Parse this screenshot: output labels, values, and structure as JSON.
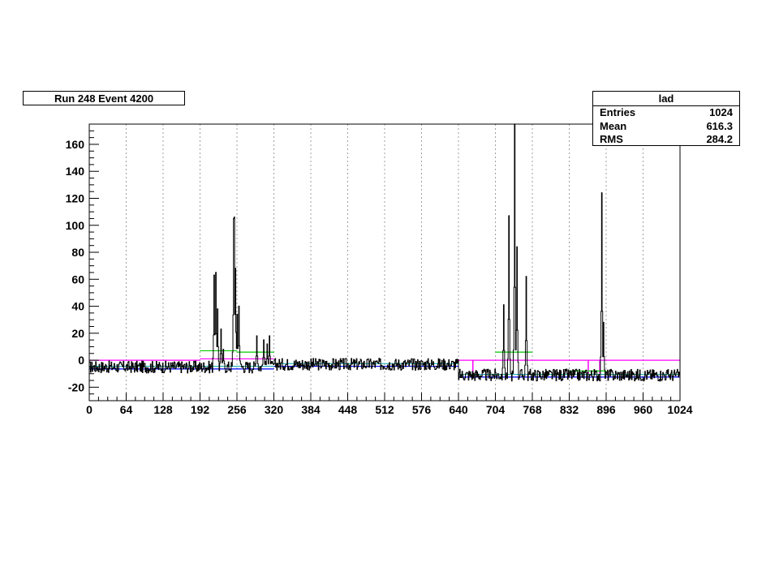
{
  "header": {
    "run_label": "Run 248 Event 4200"
  },
  "stats": {
    "title": "lad",
    "rows": [
      {
        "label": "Entries",
        "value": "1024"
      },
      {
        "label": "Mean",
        "value": "616.3"
      },
      {
        "label": "RMS",
        "value": "284.2"
      }
    ]
  },
  "colors": {
    "signal": "#000000",
    "pedestal": "#00cc00",
    "threshold": "#ff00ff",
    "baseline": "#0000ff",
    "common": "#00aaaa"
  },
  "chart_data": {
    "type": "line",
    "title": "",
    "xlabel": "",
    "ylabel": "",
    "xlim": [
      0,
      1024
    ],
    "ylim": [
      -30,
      175
    ],
    "xticks": [
      0,
      64,
      128,
      192,
      256,
      320,
      384,
      448,
      512,
      576,
      640,
      704,
      768,
      832,
      896,
      960,
      1024
    ],
    "yticks": [
      -20,
      0,
      20,
      40,
      60,
      80,
      100,
      120,
      140,
      160
    ],
    "grid": "vertical-dotted",
    "segments_baseline": [
      {
        "x": [
          0,
          192
        ],
        "y": -5
      },
      {
        "x": [
          192,
          320
        ],
        "y": -5
      },
      {
        "x": [
          320,
          640
        ],
        "y": -3
      },
      {
        "x": [
          640,
          1024
        ],
        "y": -11
      }
    ],
    "peaks": [
      {
        "x": 216,
        "y": 63
      },
      {
        "x": 219,
        "y": 65
      },
      {
        "x": 222,
        "y": 38
      },
      {
        "x": 228,
        "y": 23
      },
      {
        "x": 232,
        "y": 8
      },
      {
        "x": 250,
        "y": 105
      },
      {
        "x": 251,
        "y": 106
      },
      {
        "x": 253,
        "y": 68
      },
      {
        "x": 256,
        "y": 34
      },
      {
        "x": 259,
        "y": 40
      },
      {
        "x": 290,
        "y": 18
      },
      {
        "x": 302,
        "y": 15
      },
      {
        "x": 308,
        "y": 12
      },
      {
        "x": 312,
        "y": 18
      },
      {
        "x": 718,
        "y": 41
      },
      {
        "x": 727,
        "y": 107
      },
      {
        "x": 737,
        "y": 175
      },
      {
        "x": 741,
        "y": 84
      },
      {
        "x": 757,
        "y": 62
      },
      {
        "x": 888,
        "y": 124
      },
      {
        "x": 891,
        "y": 28
      }
    ],
    "pedestal_lines": [
      {
        "x": [
          192,
          256
        ],
        "y": 7
      },
      {
        "x": [
          256,
          320
        ],
        "y": 6
      },
      {
        "x": [
          704,
          768
        ],
        "y": 6
      },
      {
        "x": [
          832,
          896
        ],
        "y": -8
      }
    ],
    "threshold_lines": [
      {
        "x": [
          0,
          192
        ],
        "y": 0
      },
      {
        "x": [
          192,
          320
        ],
        "y": 1
      },
      {
        "x": [
          640,
          1024
        ],
        "y": 0
      }
    ]
  }
}
